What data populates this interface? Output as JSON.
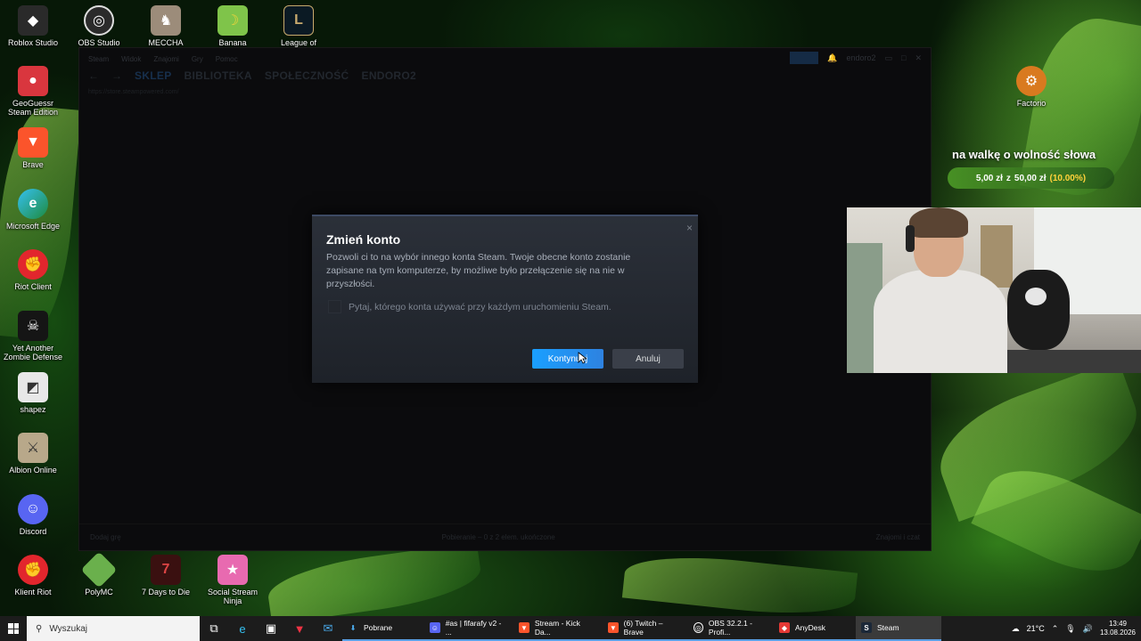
{
  "desktop": {
    "icons": [
      {
        "label": "Roblox Studio"
      },
      {
        "label": "OBS Studio"
      },
      {
        "label": "MECCHA CHAMELEON"
      },
      {
        "label": "Banana"
      },
      {
        "label": "League of Legends"
      },
      {
        "label": "GeoGuessr Steam Edition"
      },
      {
        "label": "Brave"
      },
      {
        "label": "Microsoft Edge"
      },
      {
        "label": "Riot Client"
      },
      {
        "label": "Yet Another Zombie Defense"
      },
      {
        "label": "shapez"
      },
      {
        "label": "Albion Online"
      },
      {
        "label": "Discord"
      },
      {
        "label": "Klient Riot"
      },
      {
        "label": "PolyMC"
      },
      {
        "label": "7 Days to Die"
      },
      {
        "label": "Social Stream Ninja"
      },
      {
        "label": "Factorio"
      }
    ]
  },
  "steam": {
    "menu": [
      "Steam",
      "Widok",
      "Znajomi",
      "Gry",
      "Pomoc"
    ],
    "user": "endoro2",
    "tabs": [
      "SKLEP",
      "BIBLIOTEKA",
      "SPOŁECZNOŚĆ",
      "ENDORO2"
    ],
    "url": "https://store.steampowered.com/",
    "bottom_left": "Dodaj grę",
    "bottom_center": "Pobieranie – 0 z 2 elem. ukończone",
    "bottom_right": "Znajomi i czat"
  },
  "dialog": {
    "title": "Zmień konto",
    "body": "Pozwoli ci to na wybór innego konta Steam. Twoje obecne konto zostanie zapisane na tym komputerze, by możliwe było przełączenie się na nie w przyszłości.",
    "checkbox_label": "Pytaj, którego konta używać przy każdym uruchomieniu Steam.",
    "checkbox_checked": false,
    "primary_label": "Kontynuuj",
    "secondary_label": "Anuluj",
    "close_glyph": "×"
  },
  "overlay": {
    "donation_title": "na walkę o wolność słowa",
    "donation_current": "5,00 zł",
    "donation_sep": "z",
    "donation_goal": "50,00 zł",
    "donation_pct": "(10.00%)"
  },
  "taskbar": {
    "search_placeholder": "Wyszukaj",
    "apps": [
      {
        "label": "Pobrane",
        "icon": "download-icon"
      },
      {
        "label": "#as | fifarafy v2 - ...",
        "icon": "discord-icon"
      },
      {
        "label": "Stream - Kick Da...",
        "icon": "brave-icon"
      },
      {
        "label": "(6) Twitch – Brave",
        "icon": "brave-icon"
      },
      {
        "label": "OBS 32.2.1 - Profi...",
        "icon": "obs-icon"
      },
      {
        "label": "AnyDesk",
        "icon": "anydesk-icon"
      },
      {
        "label": "Steam",
        "icon": "steam-icon"
      }
    ],
    "weather": "21°C",
    "time": "13:49",
    "date": "13.08.2026"
  },
  "colors": {
    "accent": "#1a9fff",
    "dialog_bg": "#262a31",
    "taskbar_bg": "#1c1c1c"
  }
}
